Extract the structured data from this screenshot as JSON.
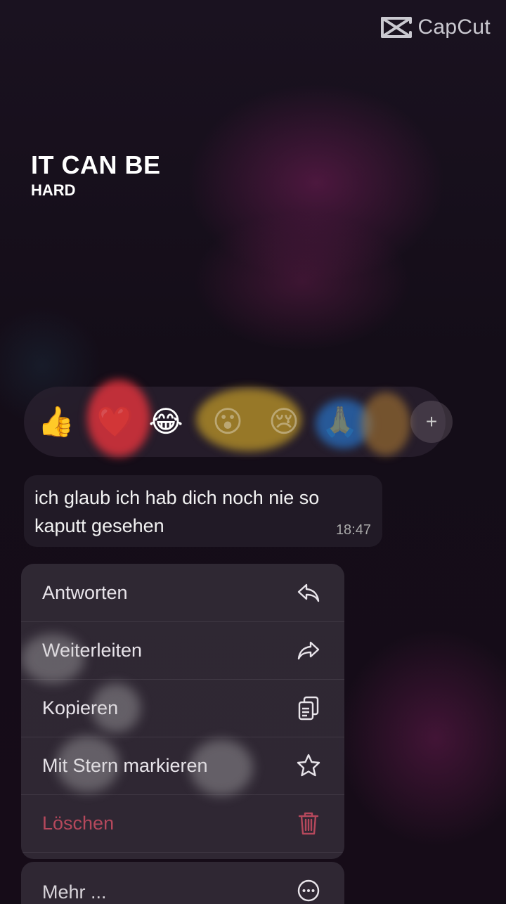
{
  "watermark": {
    "text": "CapCut"
  },
  "caption": {
    "line1": "IT CAN BE",
    "line2": "HARD"
  },
  "reactions": {
    "emojis": [
      "👍",
      "❤️",
      "😂",
      "😮",
      "😢",
      "🙏"
    ],
    "more_symbol": "+"
  },
  "message": {
    "text": "ich glaub ich hab dich noch nie so kaputt gesehen",
    "time": "18:47"
  },
  "menu": {
    "items": [
      {
        "label": "Antworten",
        "icon": "reply-icon"
      },
      {
        "label": "Weiterleiten",
        "icon": "forward-icon"
      },
      {
        "label": "Kopieren",
        "icon": "copy-icon"
      },
      {
        "label": "Mit Stern markieren",
        "icon": "star-icon"
      },
      {
        "label": "Löschen",
        "icon": "trash-icon"
      }
    ],
    "more": {
      "label": "Mehr ...",
      "icon": "more-icon"
    }
  },
  "colors": {
    "danger": "#b5485c",
    "bubble": "#221c28",
    "menu": "#322a36"
  }
}
